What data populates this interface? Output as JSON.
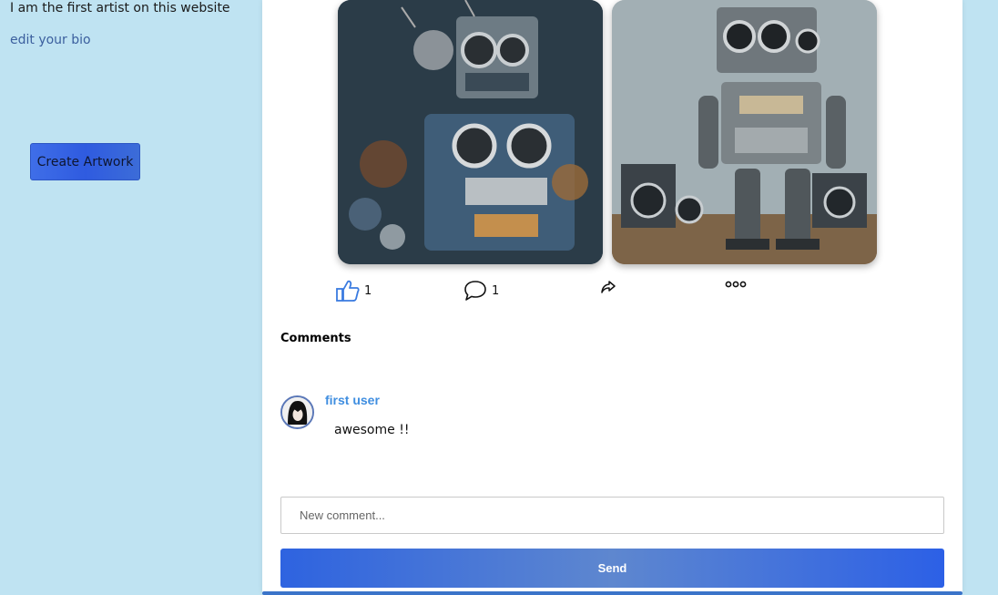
{
  "sidebar": {
    "bio_text": "I am the first artist on this website",
    "edit_bio_label": "edit your bio",
    "create_artwork_label": "Create Artwork"
  },
  "post": {
    "images": [
      {
        "icon": "robot-artwork-1"
      },
      {
        "icon": "robot-artwork-2"
      }
    ],
    "actions": {
      "like_count": "1",
      "comment_count": "1",
      "like_icon": "thumbs-up-icon",
      "comment_icon": "speech-bubble-icon",
      "share_icon": "share-arrow-icon",
      "more_icon": "more-dots-icon"
    }
  },
  "comments": {
    "title": "Comments",
    "items": [
      {
        "user": "first user",
        "text": "awesome !!"
      }
    ],
    "input_placeholder": "New comment...",
    "send_label": "Send"
  },
  "colors": {
    "page_bg": "#bfe3f2",
    "accent": "#2e63e0",
    "username": "#3f8ee0"
  }
}
